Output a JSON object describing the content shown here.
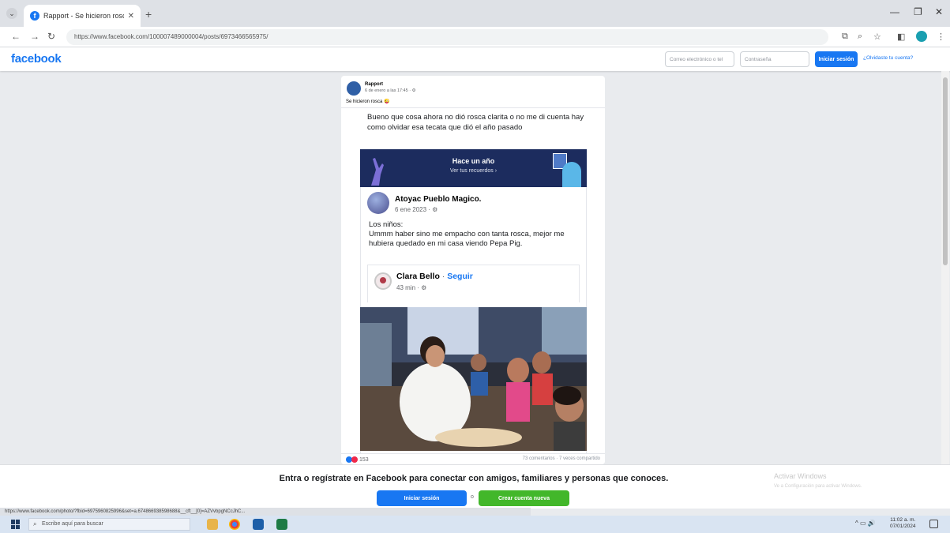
{
  "browser": {
    "tab_title": "Rapport - Se hicieron rosca 😜",
    "url": "https://www.facebook.com/100007489000004/posts/6973466565975/",
    "status_url": "https://www.facebook.com/photo/?fbid=6975960825996&set=a.674866938598688&__cft__[0]=AZVvbpgNCcJhC..."
  },
  "facebook": {
    "logo": "facebook",
    "email_placeholder": "Correo electrónico o tel",
    "password_placeholder": "Contraseña",
    "login_label": "Iniciar sesión",
    "forgot_label": "¿Olvidaste tu cuenta?"
  },
  "post": {
    "author": "Rapport",
    "time": "6 de enero a las 17:45 · ⚙",
    "feeling": "Se hicieron rosca 😜",
    "text": "Bueno que cosa ahora no dió rosca clarita o no me di cuenta hay como olvidar esa tecata que dió el año pasado",
    "memory": {
      "title": "Hace un año",
      "subtitle": "Ver tus recuerdos ›"
    },
    "shared": {
      "author": "Atoyac Pueblo Magico.",
      "time": "6 ene 2023 · ⚙",
      "text": "Los niños:\nUmmm haber sino me empacho con tanta rosca, mejor me hubiera quedado en mi casa viendo Pepa Pig.",
      "nested": {
        "author": "Clara Bello",
        "dot": " · ",
        "follow": "Seguir",
        "time": "43 min · ⚙"
      }
    },
    "reactions_count": "153",
    "comments": "73 comentarios · 7 veces compartido"
  },
  "banner": {
    "text": "Entra o regístrate en Facebook para conectar con amigos, familiares y personas que conoces.",
    "login_label": "Iniciar sesión",
    "separator": "o",
    "create_label": "Crear cuenta nueva",
    "activate_title": "Activar Windows",
    "activate_sub": "Ve a Configuración para activar Windows."
  },
  "taskbar": {
    "search_placeholder": "Escribe aquí para buscar",
    "time": "11:02 a. m.",
    "date": "07/01/2024"
  },
  "colors": {
    "brand": "#1877f2",
    "create_green": "#42b72a"
  }
}
